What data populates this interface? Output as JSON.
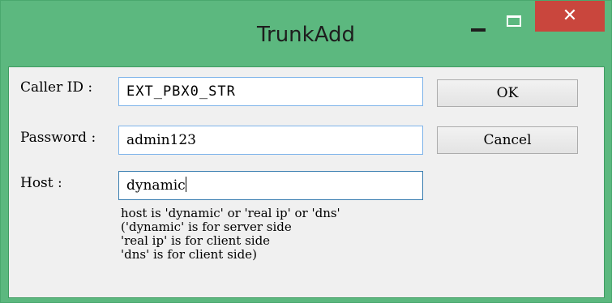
{
  "window": {
    "title": "TrunkAdd",
    "minimize_symbol": "–",
    "close_symbol": "✕"
  },
  "form": {
    "caller_id": {
      "label": "Caller ID :",
      "value": "EXT_PBX0_STR"
    },
    "password": {
      "label": "Password :",
      "value": "admin123"
    },
    "host": {
      "label": "Host :",
      "value": "dynamic"
    }
  },
  "buttons": {
    "ok": "OK",
    "cancel": "Cancel"
  },
  "help": {
    "lines": [
      "host is 'dynamic' or 'real ip' or 'dns'",
      "('dynamic' is for server side",
      "'real ip' is for client side",
      "'dns' is for client side)"
    ]
  },
  "colors": {
    "titlebar": "#5cb87f",
    "close_button": "#c9463d",
    "focus_border": "#7eb4ea"
  }
}
